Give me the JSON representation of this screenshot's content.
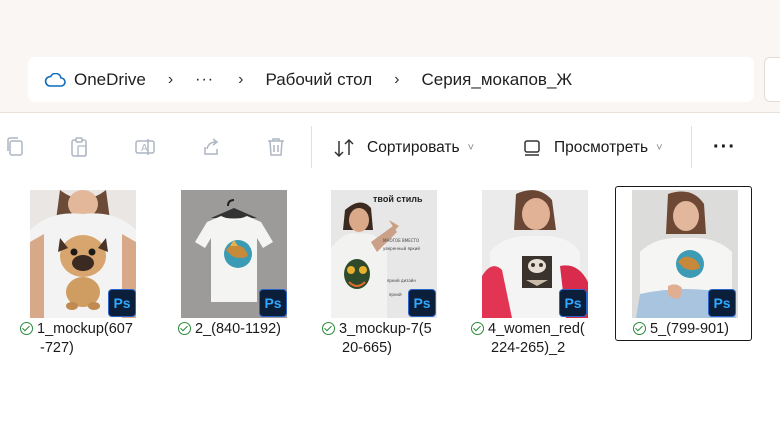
{
  "address_bar": {
    "root": "OneDrive",
    "ellipsis": "···",
    "crumbs": [
      "Рабочий стол",
      "Серия_мокапов_Ж"
    ],
    "separator": "›"
  },
  "toolbar": {
    "sort_label": "Сортировать",
    "view_label": "Просмотреть",
    "more_label": "···",
    "chevron": "˅"
  },
  "files": [
    {
      "line1": "1_mockup(607",
      "line2": "-727)",
      "status": "synced"
    },
    {
      "line1": "2_(840-1192)",
      "line2": "",
      "status": "synced"
    },
    {
      "line1": "3_mockup-7(5",
      "line2": "20-665)",
      "status": "synced"
    },
    {
      "line1": "4_women_red(",
      "line2": "224-265)_2",
      "status": "synced"
    },
    {
      "line1": "5_(799-901)",
      "line2": "",
      "status": "synced",
      "selected": true
    }
  ],
  "ps_badge": "Ps",
  "thumb3": {
    "headline": "твой стиль",
    "t1": "МНОГОЕ ВМЕСТО",
    "t2": "уверенный яркий",
    "t3": "яркий дизайн",
    "t4": "яркий"
  }
}
